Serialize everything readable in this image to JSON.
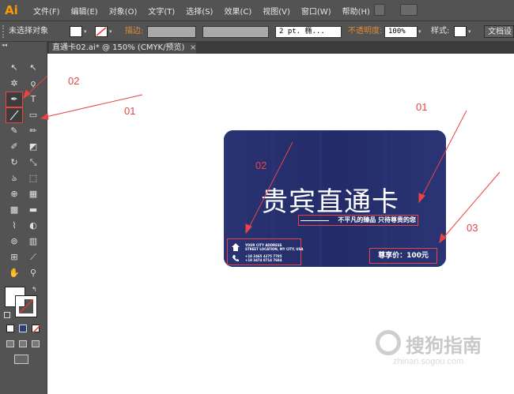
{
  "app": {
    "logo": "Ai"
  },
  "menu": [
    "文件(F)",
    "编辑(E)",
    "对象(O)",
    "文字(T)",
    "选择(S)",
    "效果(C)",
    "视图(V)",
    "窗口(W)",
    "帮助(H)"
  ],
  "control": {
    "selection": "未选择对象",
    "stroke_label": "描边:",
    "stroke_profile": "2 pt. 椭...",
    "opacity_label": "不透明度:",
    "opacity_value": "100%",
    "style_label": "样式:",
    "doc_setup": "文档设"
  },
  "document_tab": {
    "title": "直通卡02.ai* @ 150% (CMYK/预览)",
    "close": "×"
  },
  "card": {
    "title": "贵宾直通卡",
    "subtitle": "不平凡的臻品 只待尊贵的您",
    "address_lines": [
      "YOUR CITY ADDRESS",
      "STREET LOCATION, MY CITY, USA"
    ],
    "phone_lines": [
      "+18 2465 4275 7785",
      "+18 3474 8714 7684"
    ],
    "price": "尊享价：100元",
    "bg_color": "#26306f"
  },
  "annotations": [
    "02",
    "01",
    "01",
    "02",
    "03"
  ],
  "watermark": {
    "cn": "搜狗指南",
    "en": "zhinan.sogou.com"
  },
  "colors": {
    "annotation": "#e84444",
    "accent": "#ff9a00"
  }
}
